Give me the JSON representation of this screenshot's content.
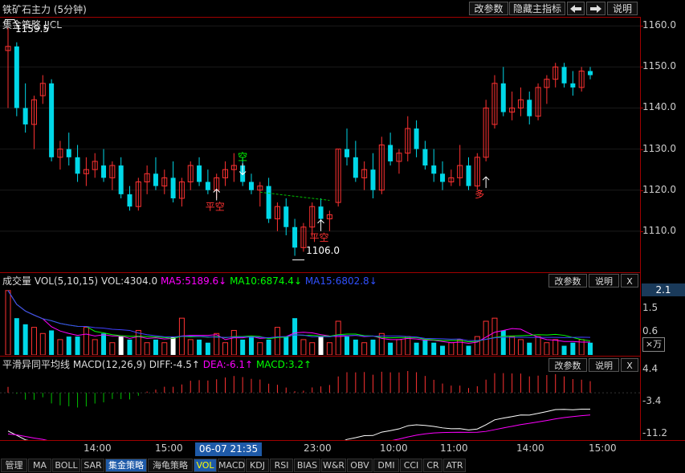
{
  "window": {
    "title": "铁矿石主力 (5分钟)"
  },
  "toolbar": {
    "params": "改参数",
    "hide_indicator": "隐藏主指标",
    "left": "◆",
    "right": "◆",
    "help": "说明"
  },
  "main_panel": {
    "strategy": "集金策略 JJCL",
    "high_label": "1159.5",
    "low_label": "1106.0",
    "signals": [
      "空",
      "平空",
      "平空",
      "多"
    ],
    "y_ticks": [
      "1160.0",
      "1150.0",
      "1140.0",
      "1130.0",
      "1120.0",
      "1110.0"
    ]
  },
  "vol_panel": {
    "title": "成交量 VOL(5,10,15)",
    "vol": "VOL:4304.0",
    "ma5": "MA5:5189.6↓",
    "ma10": "MA10:6874.4↓",
    "ma15": "MA15:6802.8↓",
    "params": "改参数",
    "help": "说明",
    "close": "X",
    "y_ticks": [
      "2.1",
      "1.5",
      "0.6"
    ],
    "unit": "×万"
  },
  "macd_panel": {
    "title": "平滑异同平均线 MACD(12,26,9)",
    "diff": "DIFF:-4.5↑",
    "dea": "DEA:-6.1↑",
    "macd": "MACD:3.2↑",
    "params": "改参数",
    "help": "说明",
    "close": "X",
    "y_ticks": [
      "4.4",
      "-3.4",
      "-11.2"
    ]
  },
  "time_axis": {
    "labels": [
      "14:00",
      "15:00",
      "23:00",
      "10:00",
      "11:00",
      "14:00",
      "15:00"
    ],
    "cursor": "06-07 21:35"
  },
  "tabs": [
    "管理",
    "MA",
    "BOLL",
    "SAR",
    "集金策略",
    "海龟策略",
    "VOL",
    "MACD",
    "KDJ",
    "RSI",
    "BIAS",
    "W&R",
    "OBV",
    "DMI",
    "CCI",
    "CR",
    "ATR"
  ],
  "colors": {
    "up": "#ff3232",
    "down": "#00d8e8",
    "panel_border": "#a00000",
    "ma5": "#ff00ff",
    "ma10": "#00ff00",
    "ma15": "#4040ff"
  },
  "chart_data": {
    "type": "candlestick",
    "ylim": [
      1100,
      1162
    ],
    "candles": [
      [
        1154,
        1159.5,
        1140,
        1155
      ],
      [
        1155,
        1156,
        1138,
        1140
      ],
      [
        1140,
        1146,
        1134,
        1136
      ],
      [
        1136,
        1143,
        1130,
        1142
      ],
      [
        1143,
        1148,
        1141,
        1146
      ],
      [
        1146,
        1147,
        1127,
        1128
      ],
      [
        1128,
        1132,
        1125,
        1130
      ],
      [
        1130,
        1134,
        1126,
        1128
      ],
      [
        1128,
        1131,
        1122,
        1124
      ],
      [
        1124,
        1128,
        1121,
        1125
      ],
      [
        1125,
        1129,
        1123,
        1127
      ],
      [
        1126,
        1130,
        1122,
        1123
      ],
      [
        1123,
        1127,
        1120,
        1126
      ],
      [
        1126,
        1128,
        1118,
        1119
      ],
      [
        1119,
        1121,
        1115,
        1116
      ],
      [
        1116,
        1123,
        1115,
        1122
      ],
      [
        1122,
        1126,
        1119,
        1124
      ],
      [
        1124,
        1128,
        1120,
        1121
      ],
      [
        1121,
        1125,
        1119,
        1123
      ],
      [
        1123,
        1127,
        1117,
        1118
      ],
      [
        1118,
        1123,
        1116,
        1122
      ],
      [
        1122,
        1127,
        1120,
        1126
      ],
      [
        1126,
        1128,
        1121,
        1122
      ],
      [
        1122,
        1125,
        1119,
        1120
      ],
      [
        1120,
        1124,
        1118,
        1123
      ],
      [
        1123,
        1127,
        1121,
        1125
      ],
      [
        1125,
        1129,
        1122,
        1126
      ],
      [
        1126,
        1128,
        1121,
        1122
      ],
      [
        1122,
        1124,
        1119,
        1120
      ],
      [
        1120,
        1122,
        1116,
        1121
      ],
      [
        1121,
        1123,
        1112,
        1113
      ],
      [
        1113,
        1117,
        1110,
        1116
      ],
      [
        1116,
        1118,
        1109,
        1111
      ],
      [
        1111,
        1113,
        1104,
        1106
      ],
      [
        1106,
        1112,
        1105,
        1111
      ],
      [
        1111,
        1117,
        1109,
        1116
      ],
      [
        1116,
        1118,
        1112,
        1113
      ],
      [
        1113,
        1115,
        1110,
        1114
      ],
      [
        1117,
        1130,
        1116,
        1130
      ],
      [
        1130,
        1135,
        1126,
        1128
      ],
      [
        1128,
        1132,
        1122,
        1123
      ],
      [
        1123,
        1127,
        1120,
        1125
      ],
      [
        1125,
        1129,
        1118,
        1120
      ],
      [
        1120,
        1133,
        1119,
        1131
      ],
      [
        1131,
        1134,
        1126,
        1127
      ],
      [
        1127,
        1130,
        1124,
        1129
      ],
      [
        1129,
        1138,
        1127,
        1135
      ],
      [
        1135,
        1137,
        1128,
        1130
      ],
      [
        1130,
        1132,
        1125,
        1126
      ],
      [
        1126,
        1130,
        1122,
        1124
      ],
      [
        1124,
        1127,
        1120,
        1122
      ],
      [
        1122,
        1125,
        1121,
        1123
      ],
      [
        1123,
        1131,
        1121,
        1126
      ],
      [
        1126,
        1128,
        1120,
        1121
      ],
      [
        1121,
        1129,
        1120,
        1128
      ],
      [
        1128,
        1142,
        1127,
        1140
      ],
      [
        1136,
        1148,
        1135,
        1146
      ],
      [
        1146,
        1150,
        1138,
        1139
      ],
      [
        1139,
        1144,
        1137,
        1140
      ],
      [
        1140,
        1145,
        1138,
        1142
      ],
      [
        1142,
        1144,
        1136,
        1138
      ],
      [
        1138,
        1146,
        1137,
        1145
      ],
      [
        1145,
        1148,
        1141,
        1147
      ],
      [
        1147,
        1151,
        1145,
        1150
      ],
      [
        1150,
        1151,
        1145,
        1146
      ],
      [
        1146,
        1149,
        1143,
        1145
      ],
      [
        1145,
        1150,
        1144,
        1149
      ],
      [
        1149,
        1150,
        1147,
        1148
      ]
    ],
    "volumes": [
      2.1,
      1.2,
      1.0,
      0.9,
      0.7,
      0.8,
      0.5,
      0.6,
      0.6,
      0.9,
      0.5,
      0.7,
      0.4,
      0.6,
      0.5,
      0.8,
      0.4,
      0.5,
      0.4,
      0.6,
      1.2,
      0.5,
      0.5,
      0.4,
      0.7,
      0.4,
      0.8,
      0.5,
      0.6,
      0.4,
      0.5,
      0.9,
      0.6,
      1.2,
      0.5,
      0.4,
      0.6,
      0.4,
      1.1,
      0.6,
      0.5,
      0.4,
      0.5,
      0.7,
      0.4,
      0.5,
      0.6,
      0.4,
      0.5,
      0.4,
      0.3,
      0.4,
      0.5,
      0.3,
      0.6,
      1.1,
      1.2,
      0.8,
      0.6,
      0.5,
      0.4,
      0.6,
      0.4,
      0.5,
      0.3,
      0.4,
      0.5,
      0.4
    ],
    "macd": {
      "diff_end": -4.5,
      "dea_end": -6.1,
      "macd_end": 3.2,
      "ylim": [
        -13,
        6
      ]
    }
  }
}
